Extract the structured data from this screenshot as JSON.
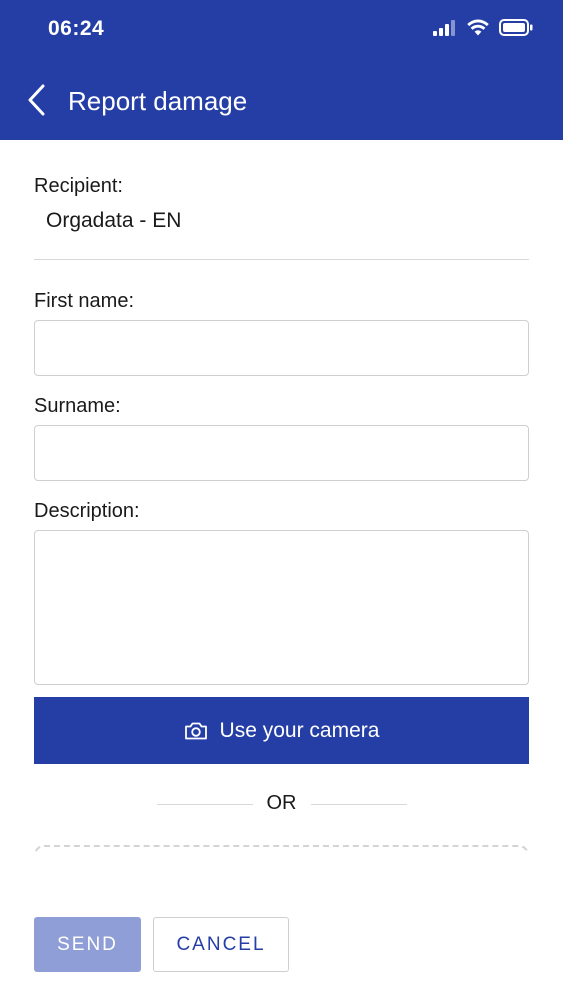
{
  "status_bar": {
    "time": "06:24",
    "icons": [
      "signal-icon",
      "wifi-icon",
      "battery-icon"
    ]
  },
  "header": {
    "back_icon": "chevron-left-icon",
    "title": "Report damage",
    "background_color": "#243ea6"
  },
  "form": {
    "recipient": {
      "label": "Recipient:",
      "value": "Orgadata - EN"
    },
    "first_name": {
      "label": "First name:",
      "value": "",
      "placeholder": ""
    },
    "surname": {
      "label": "Surname:",
      "value": "",
      "placeholder": ""
    },
    "description": {
      "label": "Description:",
      "value": "",
      "placeholder": ""
    }
  },
  "camera_button": {
    "icon": "camera-icon",
    "label": "Use your camera"
  },
  "separator": {
    "label": "OR"
  },
  "actions": {
    "send_label": "SEND",
    "cancel_label": "CANCEL",
    "send_disabled_color": "#8f9ed6",
    "accent_color": "#243ea6"
  }
}
